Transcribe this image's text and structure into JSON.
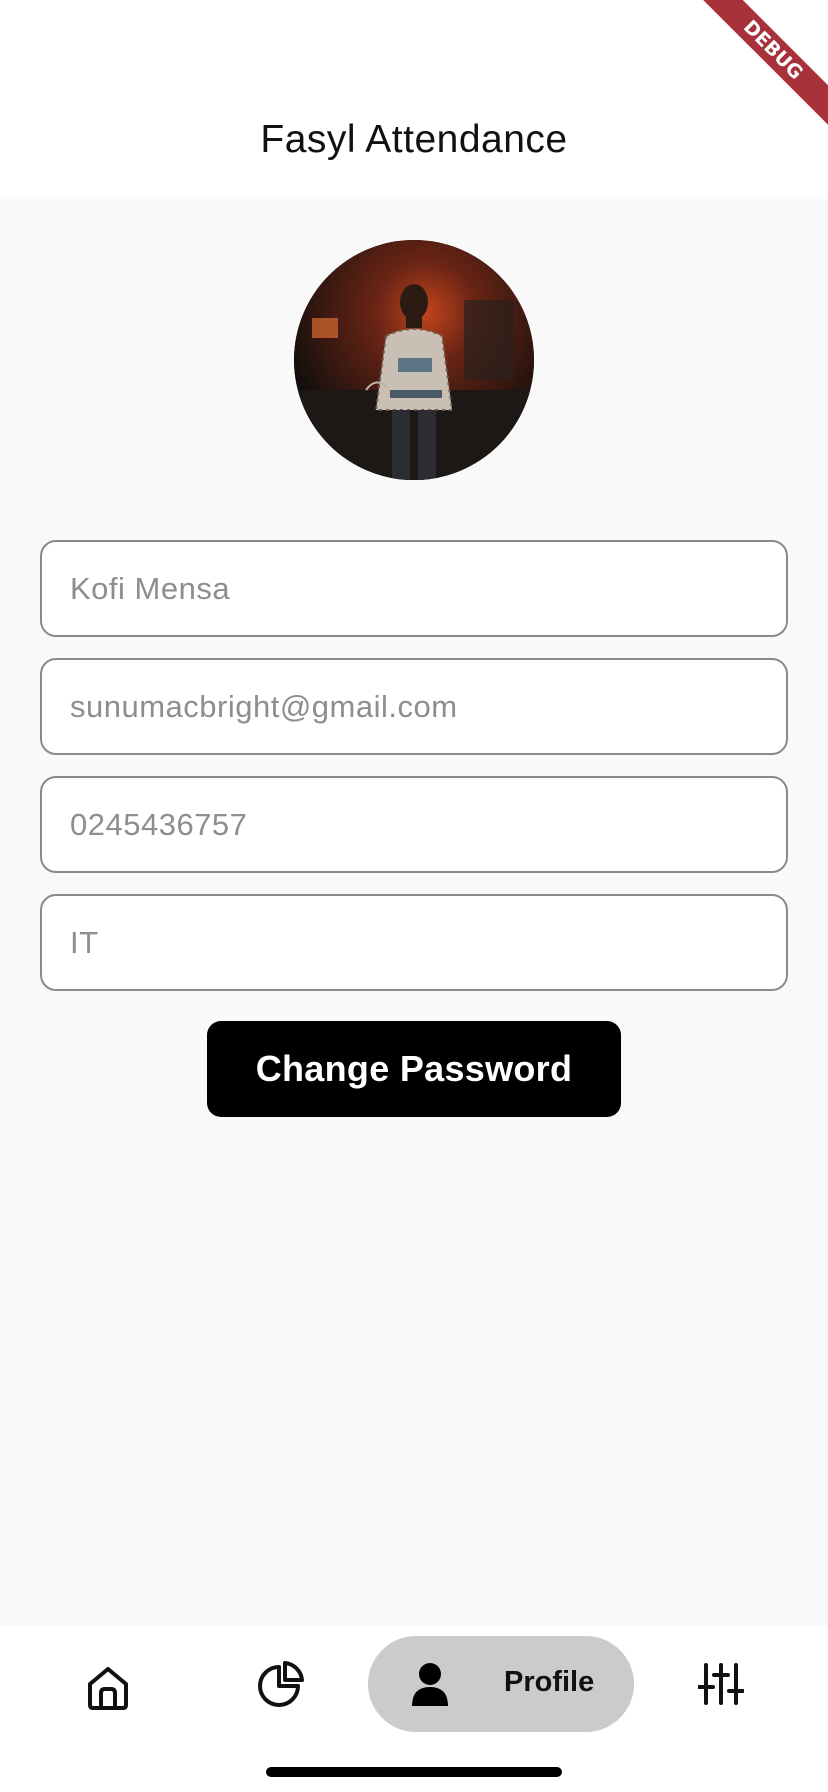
{
  "app": {
    "title": "Fasyl Attendance",
    "debug_label": "DEBUG"
  },
  "profile": {
    "name": "Kofi Mensa",
    "email": "sunumacbright@gmail.com",
    "phone": "0245436757",
    "department": "IT"
  },
  "actions": {
    "change_password_label": "Change Password"
  },
  "bottom_nav": {
    "items": [
      {
        "icon": "home-icon"
      },
      {
        "icon": "pie-chart-icon"
      },
      {
        "icon": "person-icon",
        "label": "Profile",
        "selected": true
      },
      {
        "icon": "sliders-icon"
      }
    ]
  },
  "colors": {
    "background": "#f9f9f9",
    "button": "#000000",
    "nav_selected_bg": "#cbcbcb",
    "field_border": "#8a8a8a",
    "debug_ribbon": "#a7323b"
  }
}
